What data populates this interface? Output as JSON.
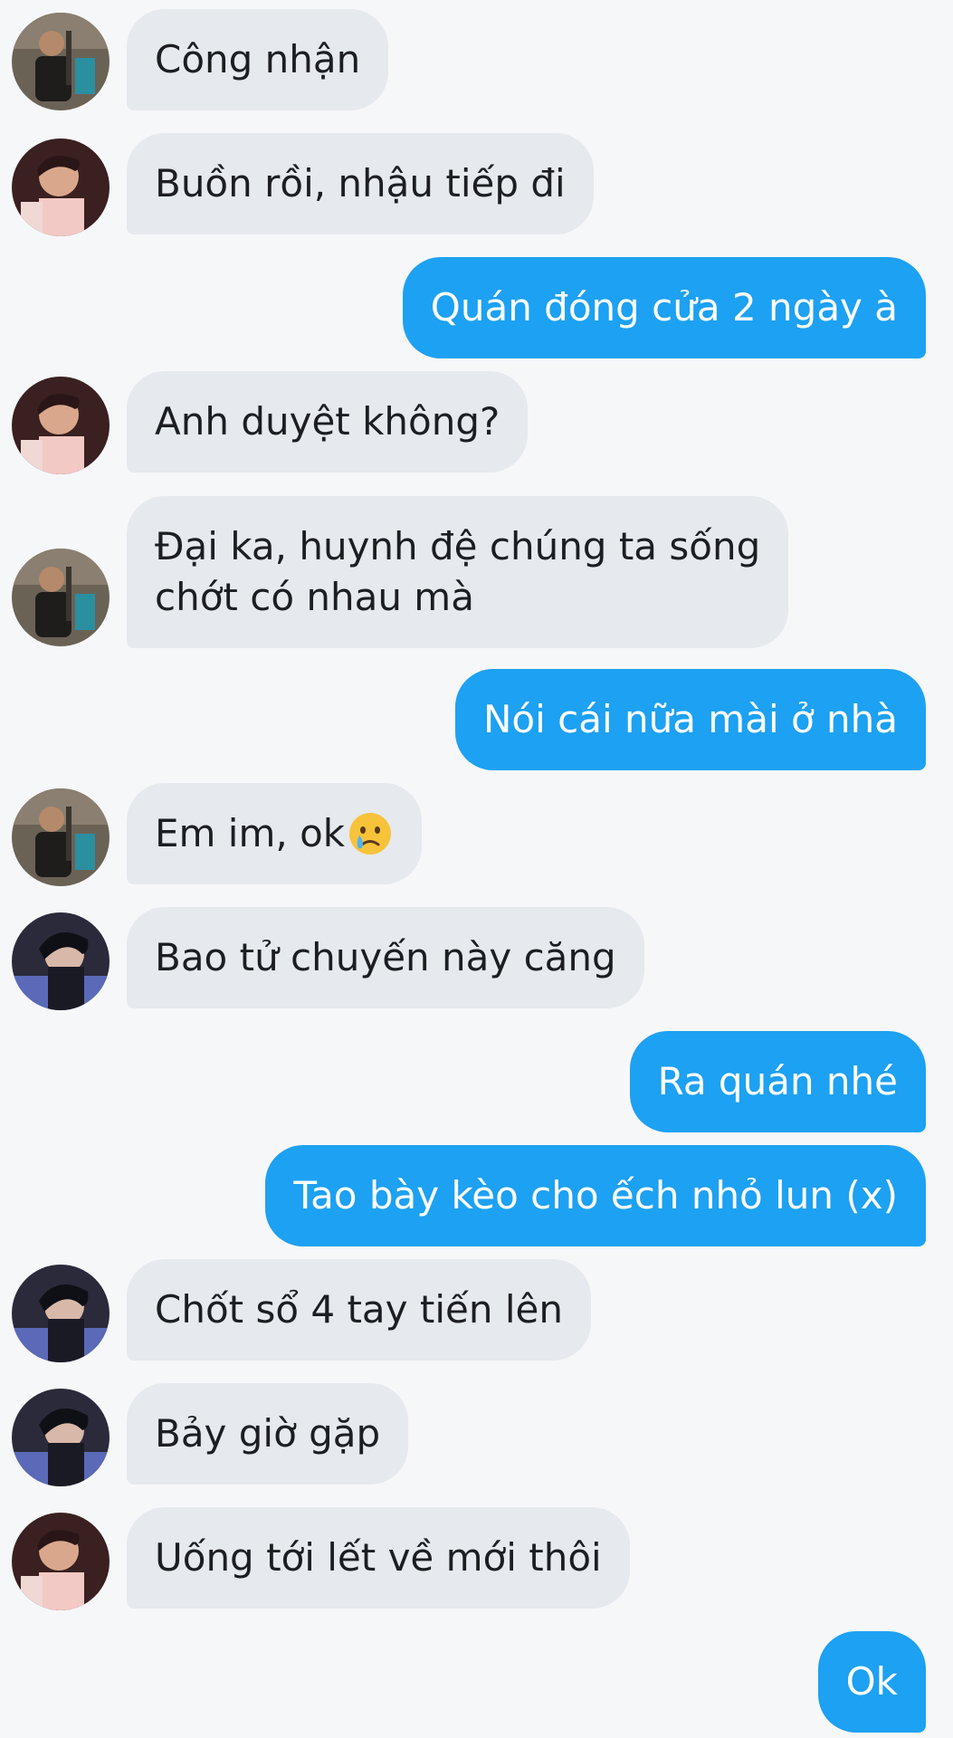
{
  "conversation": {
    "messages": [
      {
        "side": "in",
        "avatar": "person-a-avatar",
        "text": "Công nhận"
      },
      {
        "side": "in",
        "avatar": "person-b-avatar",
        "text": "Buồn rồi, nhậu tiếp đi"
      },
      {
        "side": "out",
        "text": "Quán đóng cửa 2 ngày à"
      },
      {
        "side": "in",
        "avatar": "person-b-avatar",
        "text": "Anh duyệt không?"
      },
      {
        "side": "in",
        "avatar": "person-a-avatar",
        "text": "Đại ka, huynh đệ chúng ta sống chớt có nhau mà",
        "line1": "Đại ka, huynh đệ chúng ta sống",
        "line2": "chớt có nhau mà"
      },
      {
        "side": "out",
        "text": "Nói cái nữa mài ở nhà"
      },
      {
        "side": "in",
        "avatar": "person-a-avatar",
        "text": "Em im, ok",
        "emoji": "crying-face-icon"
      },
      {
        "side": "in",
        "avatar": "person-c-avatar",
        "text": "Bao tử chuyến này căng"
      },
      {
        "side": "out",
        "text": "Ra quán nhé"
      },
      {
        "side": "out",
        "text": "Tao bày kèo cho ếch nhỏ lun (x)"
      },
      {
        "side": "in",
        "avatar": "person-c-avatar",
        "text": "Chốt sổ 4 tay tiến lên"
      },
      {
        "side": "in",
        "avatar": "person-c-avatar",
        "text": "Bảy giờ gặp"
      },
      {
        "side": "in",
        "avatar": "person-b-avatar",
        "text": "Uống tới lết về mới thôi"
      },
      {
        "side": "out",
        "text": "Ok"
      }
    ]
  },
  "colors": {
    "background": "#f6f7f9",
    "incoming_bubble": "#e6e9ed",
    "outgoing_bubble": "#1da1f2",
    "incoming_text": "#1c1e21",
    "outgoing_text": "#ffffff"
  }
}
